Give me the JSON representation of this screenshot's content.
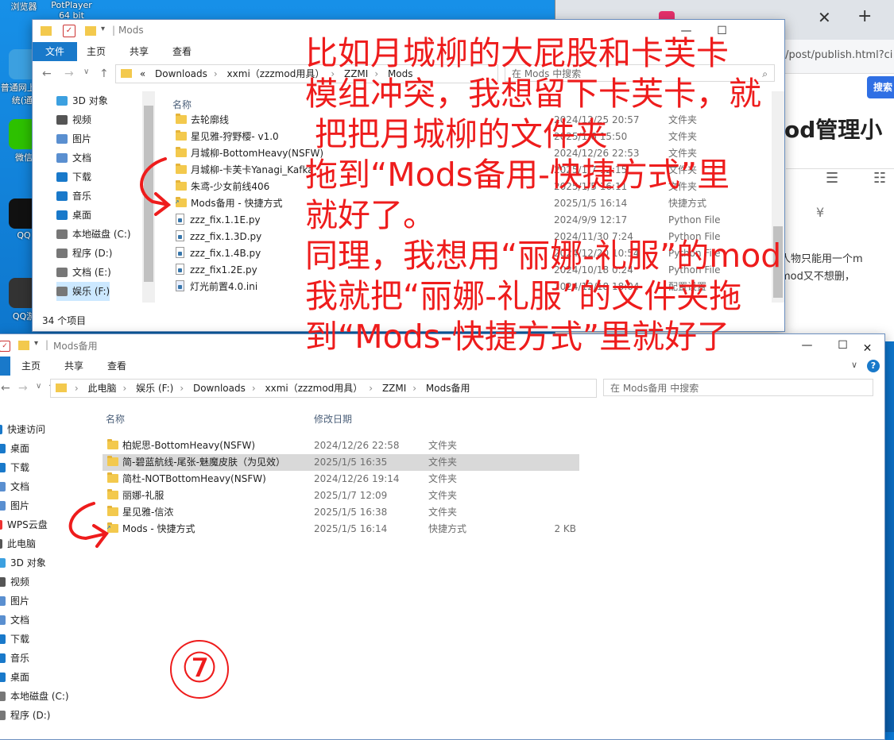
{
  "desktop": {
    "icons": [
      {
        "label": "浏览器",
        "color": "#2a8fe0"
      },
      {
        "label": "PotPlayer 64 bit",
        "color": "#f2b300"
      },
      {
        "label": "普通网上 系统(通)",
        "color": "#3ca0e0"
      },
      {
        "label": "微信",
        "color": "#2dc100"
      },
      {
        "label": "QQ",
        "color": "#111111"
      },
      {
        "label": "QQ游",
        "color": "#333333"
      },
      {
        "label": "WPS云盘",
        "color": "#e33"
      }
    ]
  },
  "browser": {
    "url_fragment": "c/post/publish.html?ci",
    "search_button": "搜索",
    "heading_fragment": "od管理小",
    "body_lines": [
      "个人物只能用一个m",
      "的mod又不想删，"
    ]
  },
  "window1": {
    "title": "Mods",
    "tabs": {
      "file": "文件",
      "home": "主页",
      "share": "共享",
      "view": "查看"
    },
    "breadcrumb": [
      "«",
      "Downloads",
      "xxmi（zzzmod用具）",
      "ZZMI",
      "Mods"
    ],
    "search_placeholder": "在 Mods 中搜索",
    "nav": [
      {
        "label": "3D 对象",
        "color": "#3ca0e0"
      },
      {
        "label": "视频",
        "color": "#555"
      },
      {
        "label": "图片",
        "color": "#5a8fd0"
      },
      {
        "label": "文档",
        "color": "#5a8fd0"
      },
      {
        "label": "下载",
        "color": "#1979ca"
      },
      {
        "label": "音乐",
        "color": "#1979ca"
      },
      {
        "label": "桌面",
        "color": "#1979ca"
      },
      {
        "label": "本地磁盘 (C:)",
        "color": "#777"
      },
      {
        "label": "程序 (D:)",
        "color": "#777"
      },
      {
        "label": "文档 (E:)",
        "color": "#777"
      },
      {
        "label": "娱乐 (F:)",
        "color": "#777"
      }
    ],
    "column_name": "名称",
    "rows": [
      {
        "name": "去轮廓线",
        "date": "2024/12/25 20:57",
        "type": "文件夹",
        "kind": "folder"
      },
      {
        "name": "星见雅-狩野樱- v1.0",
        "date": "2025/1/6 15:50",
        "type": "文件夹",
        "kind": "folder"
      },
      {
        "name": "月城柳-BottomHeavy(NSFW)",
        "date": "2024/12/26 22:53",
        "type": "文件夹",
        "kind": "folder"
      },
      {
        "name": "月城柳-卡芙卡Yanagi_Kafka",
        "date": "2025/1/7 12:15",
        "type": "文件夹",
        "kind": "folder"
      },
      {
        "name": "朱鸢-少女前线406",
        "date": "2025/1/5 16:11",
        "type": "文件夹",
        "kind": "folder"
      },
      {
        "name": "Mods备用 - 快捷方式",
        "date": "2025/1/5 16:14",
        "type": "快捷方式",
        "kind": "shortcut"
      },
      {
        "name": "zzz_fix.1.1E.py",
        "date": "2024/9/9 12:17",
        "type": "Python File",
        "kind": "py"
      },
      {
        "name": "zzz_fix.1.3D.py",
        "date": "2024/11/30 7:24",
        "type": "Python File",
        "kind": "py"
      },
      {
        "name": "zzz_fix.1.4B.py",
        "date": "2024/12/20 10:54",
        "type": "Python File",
        "kind": "py"
      },
      {
        "name": "zzz_fix1.2E.py",
        "date": "2024/10/18 0:24",
        "type": "Python File",
        "kind": "py"
      },
      {
        "name": "灯光前置4.0.ini",
        "date": "2024/12/18 18:04",
        "type": "配置设置",
        "kind": "ini"
      }
    ],
    "status": "34 个项目"
  },
  "window2": {
    "title": "Mods备用",
    "tabs": {
      "home": "主页",
      "share": "共享",
      "view": "查看"
    },
    "breadcrumb": [
      "此电脑",
      "娱乐 (F:)",
      "Downloads",
      "xxmi（zzzmod用具）",
      "ZZMI",
      "Mods备用"
    ],
    "search_placeholder": "在 Mods备用 中搜索",
    "nav": [
      {
        "label": "快速访问",
        "color": "#1979ca"
      },
      {
        "label": "桌面",
        "color": "#1979ca"
      },
      {
        "label": "下载",
        "color": "#1979ca"
      },
      {
        "label": "文档",
        "color": "#5a8fd0"
      },
      {
        "label": "图片",
        "color": "#5a8fd0"
      },
      {
        "label": "WPS云盘",
        "color": "#e33"
      },
      {
        "label": "此电脑",
        "color": "#555"
      },
      {
        "label": "3D 对象",
        "color": "#3ca0e0"
      },
      {
        "label": "视频",
        "color": "#555"
      },
      {
        "label": "图片",
        "color": "#5a8fd0"
      },
      {
        "label": "文档",
        "color": "#5a8fd0"
      },
      {
        "label": "下载",
        "color": "#1979ca"
      },
      {
        "label": "音乐",
        "color": "#1979ca"
      },
      {
        "label": "桌面",
        "color": "#1979ca"
      },
      {
        "label": "本地磁盘 (C:)",
        "color": "#777"
      },
      {
        "label": "程序 (D:)",
        "color": "#777"
      }
    ],
    "columns": {
      "name": "名称",
      "date": "修改日期"
    },
    "rows": [
      {
        "name": "柏妮思-BottomHeavy(NSFW)",
        "date": "2024/12/26 22:58",
        "type": "文件夹",
        "size": "",
        "kind": "folder",
        "selected": false
      },
      {
        "name": "简-碧蓝航线-尾张-魅魔皮肤（为见效）",
        "date": "2025/1/5 16:35",
        "type": "文件夹",
        "size": "",
        "kind": "folder",
        "selected": true
      },
      {
        "name": "简杜-NOTBottomHeavy(NSFW)",
        "date": "2024/12/26 19:14",
        "type": "文件夹",
        "size": "",
        "kind": "folder",
        "selected": false
      },
      {
        "name": "丽娜-礼服",
        "date": "2025/1/7 12:09",
        "type": "文件夹",
        "size": "",
        "kind": "folder",
        "selected": false
      },
      {
        "name": "星见雅-信浓",
        "date": "2025/1/5 16:38",
        "type": "文件夹",
        "size": "",
        "kind": "folder",
        "selected": false
      },
      {
        "name": "Mods - 快捷方式",
        "date": "2025/1/5 16:14",
        "type": "快捷方式",
        "size": "2 KB",
        "kind": "shortcut",
        "selected": false
      }
    ]
  },
  "annotation": {
    "lines": [
      "比如月城柳的大屁股和卡芙卡",
      "模组冲突，我想留下卡芙卡，就",
      "把把月城柳的文件夹",
      "拖到“Mods备用-快捷方式”里",
      "就好了。",
      "同理，我想用“丽娜-礼服”的mod",
      "我就把“丽娜-礼服”的文件夹拖",
      "到“Mods-快捷方式”里就好了"
    ],
    "step": "⑦",
    "color": "#ee1c1c"
  }
}
